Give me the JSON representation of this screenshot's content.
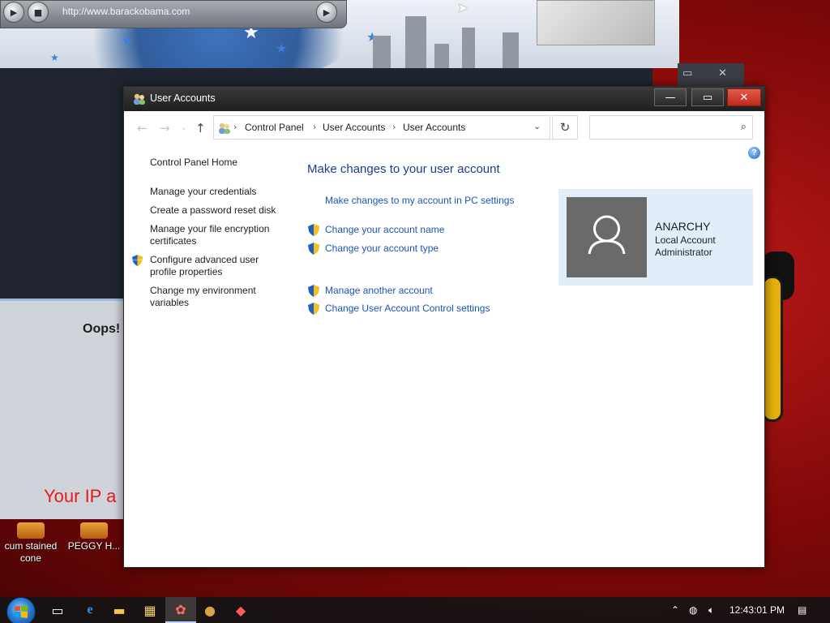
{
  "background": {
    "browser_url": "http://www.barackobama.com",
    "error_heading": "Oops!",
    "error_ip_text": "Your IP a"
  },
  "desktop_icons": [
    {
      "label": "cum stained cone"
    },
    {
      "label": "PEGGY H..."
    }
  ],
  "window": {
    "title": "User Accounts",
    "breadcrumb": [
      "Control Panel",
      "User Accounts",
      "User Accounts"
    ],
    "search_placeholder": ""
  },
  "left_pane": {
    "home": "Control Panel Home",
    "links": [
      "Manage your credentials",
      "Create a password reset disk",
      "Manage your file encryption certificates",
      "Configure advanced user profile properties",
      "Change my environment variables"
    ]
  },
  "main": {
    "heading": "Make changes to your user account",
    "pc_settings_link": "Make changes to my account in PC settings",
    "account_links": [
      "Change your account name",
      "Change your account type"
    ],
    "other_links": [
      "Manage another account",
      "Change User Account Control settings"
    ]
  },
  "account": {
    "name": "ANARCHY",
    "type": "Local Account",
    "role": "Administrator"
  },
  "taskbar": {
    "clock": "12:43:01 PM"
  },
  "colors": {
    "link": "#1b56b4",
    "heading": "#1e3c8e",
    "card_bg": "#e1eef9",
    "close_button": "#c1281b"
  }
}
